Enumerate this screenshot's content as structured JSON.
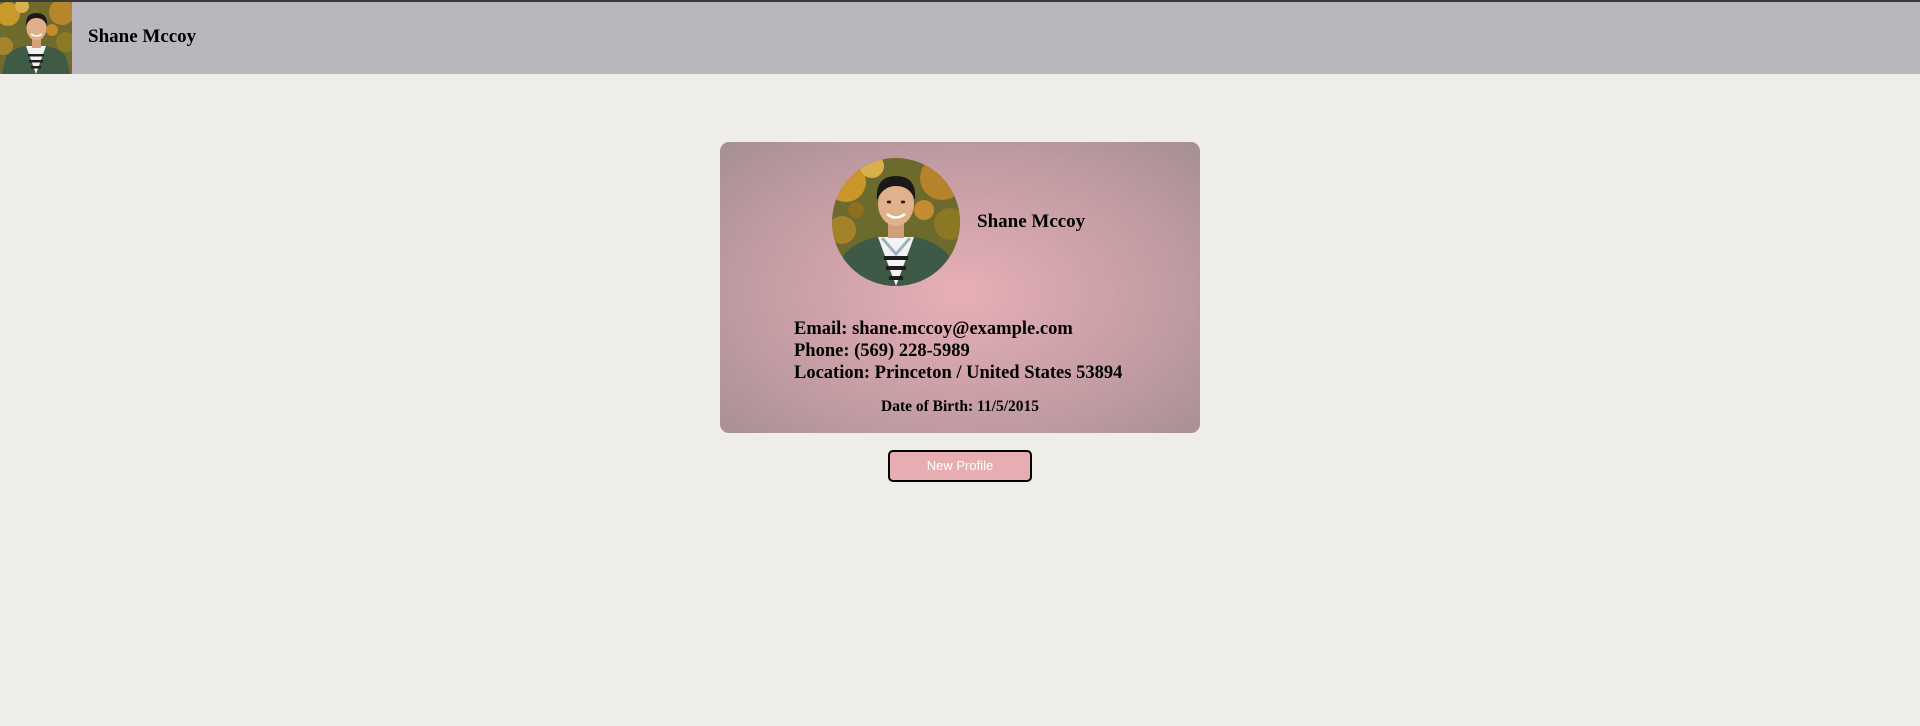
{
  "header": {
    "name": "Shane Mccoy",
    "avatar_icon": "person-photo-icon"
  },
  "profile_card": {
    "name": "Shane Mccoy",
    "avatar_icon": "person-photo-icon",
    "email_line": "Email: shane.mccoy@example.com",
    "phone_line": "Phone: (569) 228-5989",
    "location_line": "Location: Princeton / United States 53894",
    "dob_line": "Date of Birth: 11/5/2015"
  },
  "actions": {
    "new_profile_label": "New Profile"
  },
  "colors": {
    "page_background": "#efede8",
    "header_background": "#b9b6bd",
    "card_center": "#e8b0b6",
    "card_edge": "#a58f92",
    "button_background": "#e6aeb2",
    "button_border": "#000000"
  }
}
